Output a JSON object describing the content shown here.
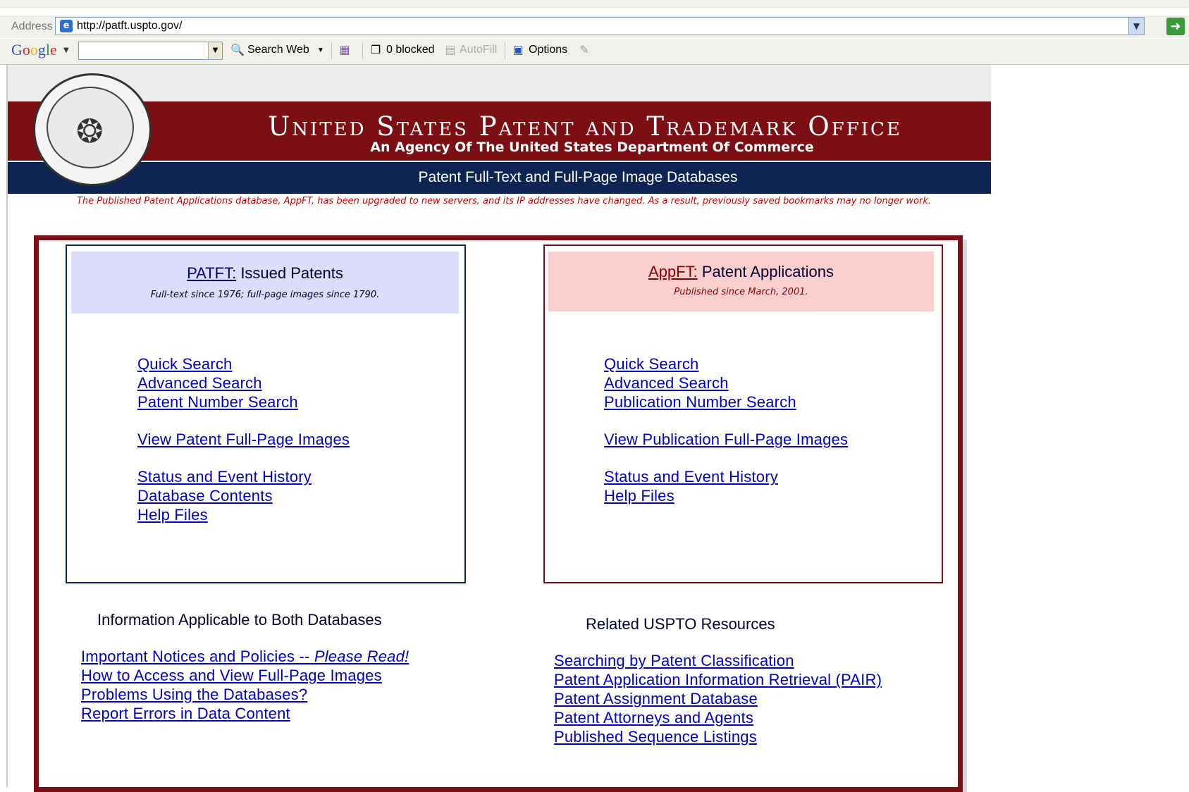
{
  "browser": {
    "address_label": "Address",
    "url": "http://patft.uspto.gov/",
    "toolbar": {
      "google_logo": "Google",
      "search_web_label": "Search Web",
      "blocked_label": "0 blocked",
      "autofill_label": "AutoFill",
      "options_label": "Options"
    }
  },
  "header": {
    "title": "United States Patent and Trademark Office",
    "subtitle": "An Agency Of The United States Department Of Commerce",
    "db_title": "Patent Full-Text and Full-Page Image Databases",
    "notice": "The Published Patent Applications database, AppFT, has been upgraded to new servers, and its IP addresses have changed. As a result, previously saved bookmarks may no longer work."
  },
  "patft": {
    "link_label": "PATFT:",
    "title_rest": " Issued Patents",
    "subtitle": "Full-text since 1976; full-page images since 1790.",
    "links": [
      "Quick Search",
      "Advanced Search",
      "Patent Number Search",
      "View Patent Full-Page Images",
      "Status and Event History",
      "Database Contents",
      "Help Files"
    ]
  },
  "appft": {
    "link_label": "AppFT:",
    "title_rest": " Patent Applications",
    "subtitle": "Published since March, 2001.",
    "links": [
      "Quick Search",
      "Advanced Search",
      "Publication Number Search",
      "View Publication Full-Page Images",
      "Status and Event History",
      "Help Files"
    ]
  },
  "info": {
    "title": "Information Applicable to Both Databases",
    "notice_link_main": "Important Notices and Policies -- ",
    "notice_link_emph": "Please Read!",
    "links": [
      "How to Access and View Full-Page Images",
      "Problems Using the Databases?",
      "Report Errors in Data Content"
    ]
  },
  "related": {
    "title": "Related USPTO Resources",
    "links": [
      "Searching by Patent Classification",
      "Patent Application Information Retrieval (PAIR)",
      "Patent Assignment Database",
      "Patent Attorneys and Agents",
      "Published Sequence Listings"
    ]
  },
  "colors": {
    "header_red": "#7b0f14",
    "header_blue": "#0e2452",
    "link": "#0000cc",
    "patft_bg": "#dcdcfb",
    "appft_bg": "#fccfcf"
  }
}
